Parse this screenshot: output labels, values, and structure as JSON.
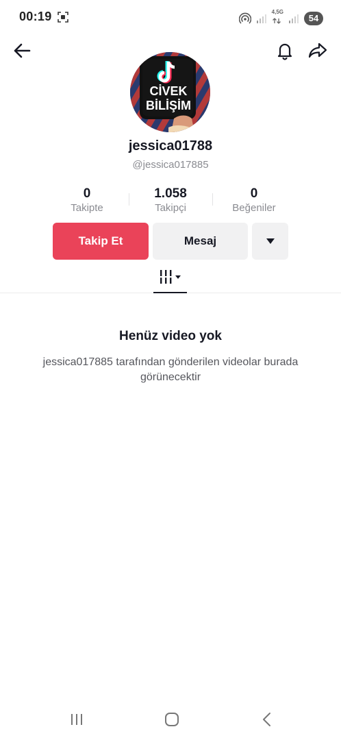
{
  "status_bar": {
    "time": "00:19",
    "network_label": "4,5G",
    "battery": "54"
  },
  "profile": {
    "avatar_text_line1": "CİVEK",
    "avatar_text_line2": "BİLİŞİM",
    "username": "jessica01788",
    "handle": "@jessica017885"
  },
  "stats": {
    "following": {
      "value": "0",
      "label": "Takipte"
    },
    "followers": {
      "value": "1.058",
      "label": "Takipçi"
    },
    "likes": {
      "value": "0",
      "label": "Beğeniler"
    }
  },
  "actions": {
    "follow_label": "Takip Et",
    "message_label": "Mesaj"
  },
  "empty_state": {
    "title": "Henüz video yok",
    "description": "jessica017885 tarafından gönderilen videolar burada görünecektir"
  },
  "colors": {
    "follow_button": "#ea4359",
    "secondary_button": "#f1f1f2",
    "text_primary": "#161823",
    "text_secondary": "#8a8b91"
  },
  "icons": {
    "back": "arrow-left-icon",
    "bell": "bell-icon",
    "share": "share-icon",
    "dropdown": "triangle-down-icon",
    "videos_tab": "grid-bars-icon",
    "sys_recent": "recent-apps-icon",
    "sys_home": "home-icon",
    "sys_back": "chevron-left-icon"
  }
}
